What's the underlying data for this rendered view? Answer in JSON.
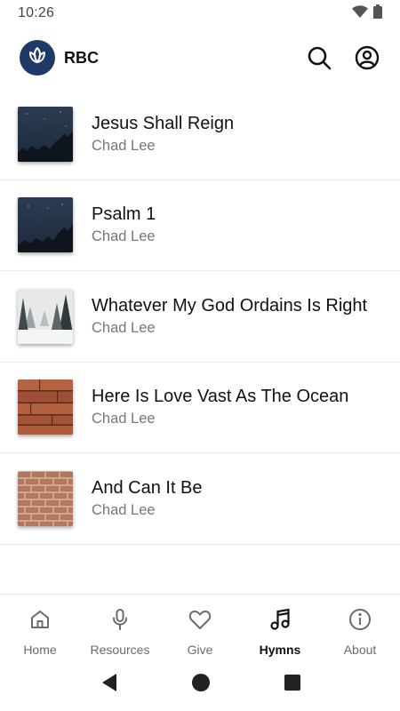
{
  "status_bar": {
    "time": "10:26"
  },
  "app_bar": {
    "title": "RBC"
  },
  "hymns": [
    {
      "title": "Jesus Shall Reign",
      "author": "Chad Lee",
      "artwork": "night-sky-trees"
    },
    {
      "title": "Psalm 1",
      "author": "Chad Lee",
      "artwork": "night-sky-trees"
    },
    {
      "title": "Whatever My God Ordains Is Right",
      "author": "Chad Lee",
      "artwork": "snowy-forest"
    },
    {
      "title": "Here Is Love Vast As The Ocean",
      "author": "Chad Lee",
      "artwork": "wood-planks"
    },
    {
      "title": "And Can It Be",
      "author": "Chad Lee",
      "artwork": "brick-wall"
    }
  ],
  "bottom_nav": {
    "items": [
      {
        "label": "Home",
        "icon": "home-icon",
        "active": false
      },
      {
        "label": "Resources",
        "icon": "microphone-icon",
        "active": false
      },
      {
        "label": "Give",
        "icon": "heart-icon",
        "active": false
      },
      {
        "label": "Hymns",
        "icon": "music-note-icon",
        "active": true
      },
      {
        "label": "About",
        "icon": "info-icon",
        "active": false
      }
    ]
  },
  "colors": {
    "brand": "#1f3a68",
    "active_text": "#111111",
    "inactive_text": "#6b6b6b"
  }
}
